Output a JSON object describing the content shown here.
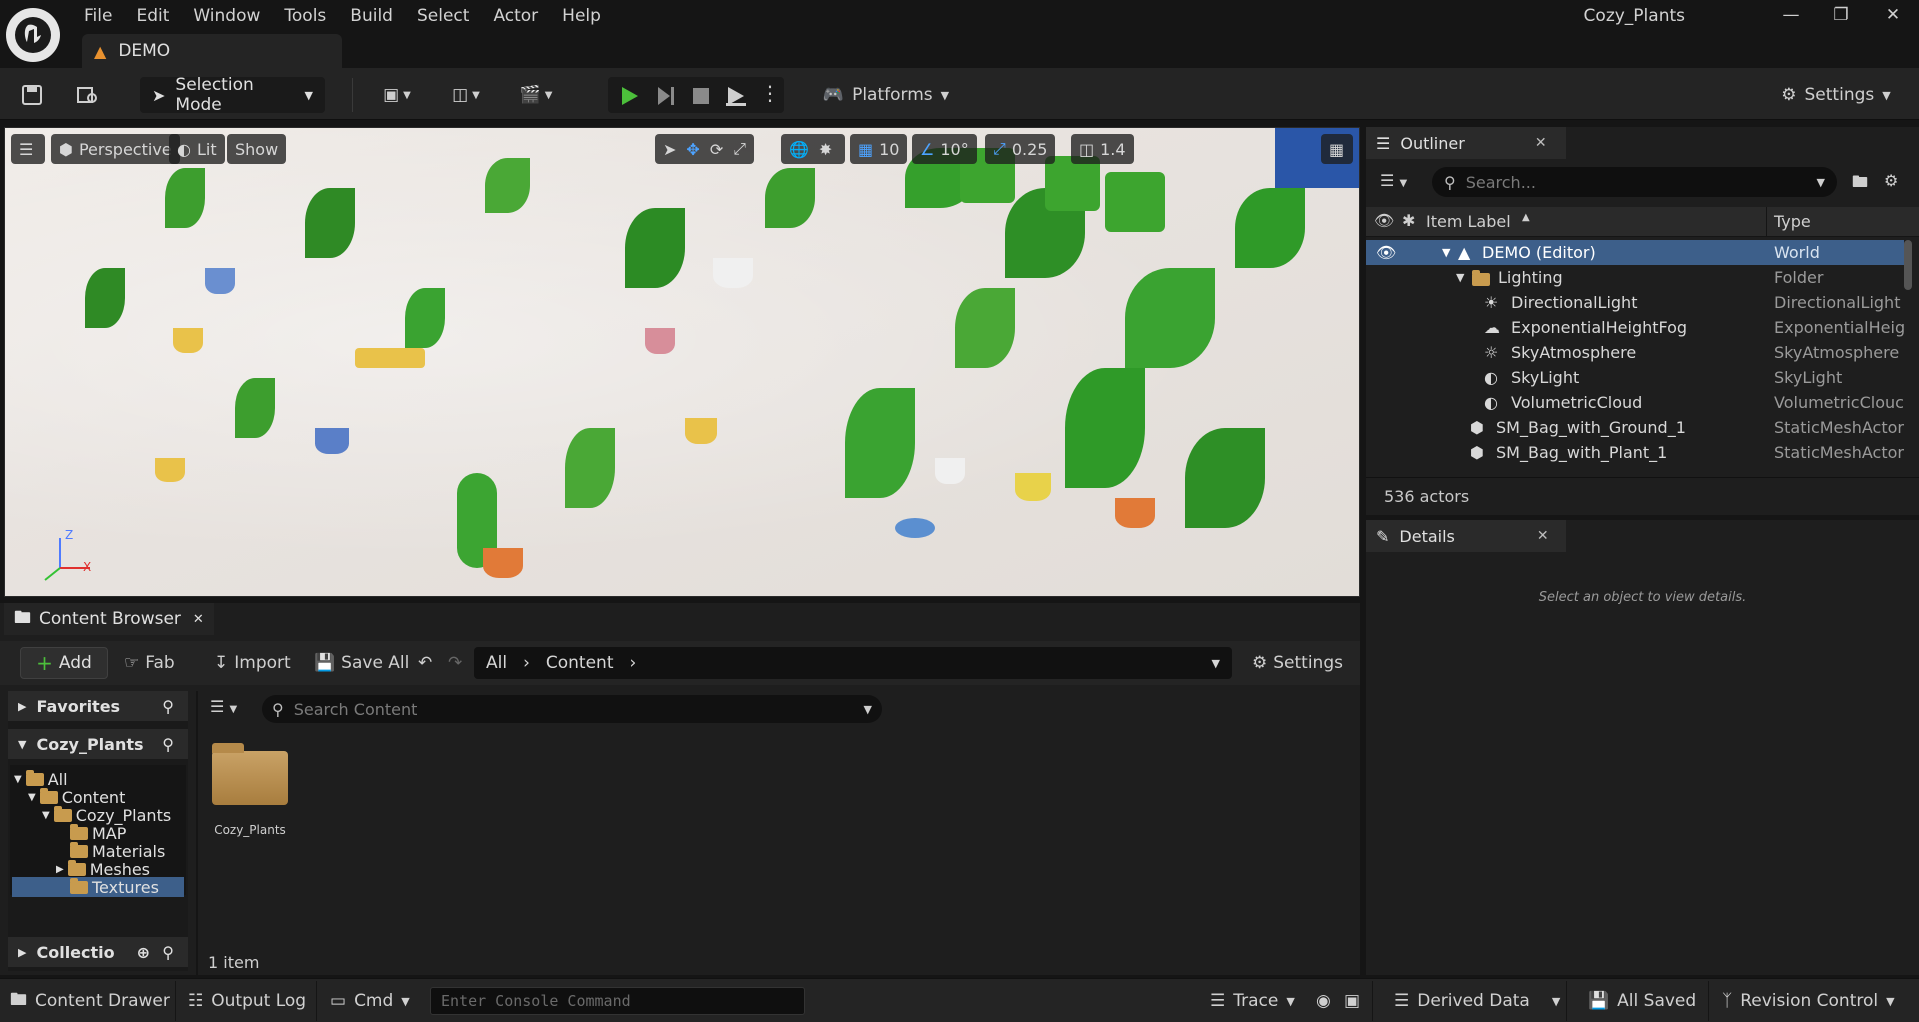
{
  "app": {
    "project_title": "Cozy_Plants",
    "level_tab": "DEMO"
  },
  "menu": [
    "File",
    "Edit",
    "Window",
    "Tools",
    "Build",
    "Select",
    "Actor",
    "Help"
  ],
  "toolbar": {
    "selection_mode": "Selection Mode",
    "platforms": "Platforms",
    "settings": "Settings"
  },
  "viewport": {
    "perspective": "Perspective",
    "lit": "Lit",
    "show": "Show",
    "grid_snap": "10",
    "rotation_snap": "10°",
    "scale_snap": "0.25",
    "camera_speed": "1.4",
    "axis_z": "Z",
    "axis_x": "X"
  },
  "outliner": {
    "title": "Outliner",
    "search_placeholder": "Search...",
    "col_label": "Item Label",
    "col_type": "Type",
    "rows": [
      {
        "label": "DEMO (Editor)",
        "type": "World"
      },
      {
        "label": "Lighting",
        "type": "Folder"
      },
      {
        "label": "DirectionalLight",
        "type": "DirectionalLight"
      },
      {
        "label": "ExponentialHeightFog",
        "type": "ExponentialHeig"
      },
      {
        "label": "SkyAtmosphere",
        "type": "SkyAtmosphere"
      },
      {
        "label": "SkyLight",
        "type": "SkyLight"
      },
      {
        "label": "VolumetricCloud",
        "type": "VolumetricClouc"
      },
      {
        "label": "SM_Bag_with_Ground_1",
        "type": "StaticMeshActor"
      },
      {
        "label": "SM_Bag_with_Plant_1",
        "type": "StaticMeshActor"
      }
    ],
    "actor_count": "536 actors"
  },
  "details": {
    "title": "Details",
    "empty_message": "Select an object to view details."
  },
  "content_browser": {
    "title": "Content Browser",
    "add": "Add",
    "fab": "Fab",
    "import": "Import",
    "save_all": "Save All",
    "breadcrumb": [
      "All",
      "Content"
    ],
    "settings": "Settings",
    "favorites": "Favorites",
    "project": "Cozy_Plants",
    "collections": "Collectio",
    "search_placeholder": "Search Content",
    "tree": [
      "All",
      "Content",
      "Cozy_Plants",
      "MAP",
      "Materials",
      "Meshes",
      "Textures"
    ],
    "asset_name": "Cozy_Plants",
    "item_count": "1 item"
  },
  "statusbar": {
    "content_drawer": "Content Drawer",
    "output_log": "Output Log",
    "cmd": "Cmd",
    "console_placeholder": "Enter Console Command",
    "trace": "Trace",
    "derived_data": "Derived Data",
    "all_saved": "All Saved",
    "revision_control": "Revision Control"
  },
  "colors": {
    "accent": "#3d5f8a",
    "play_green": "#4cbf3b",
    "warning": "#e8912f"
  }
}
